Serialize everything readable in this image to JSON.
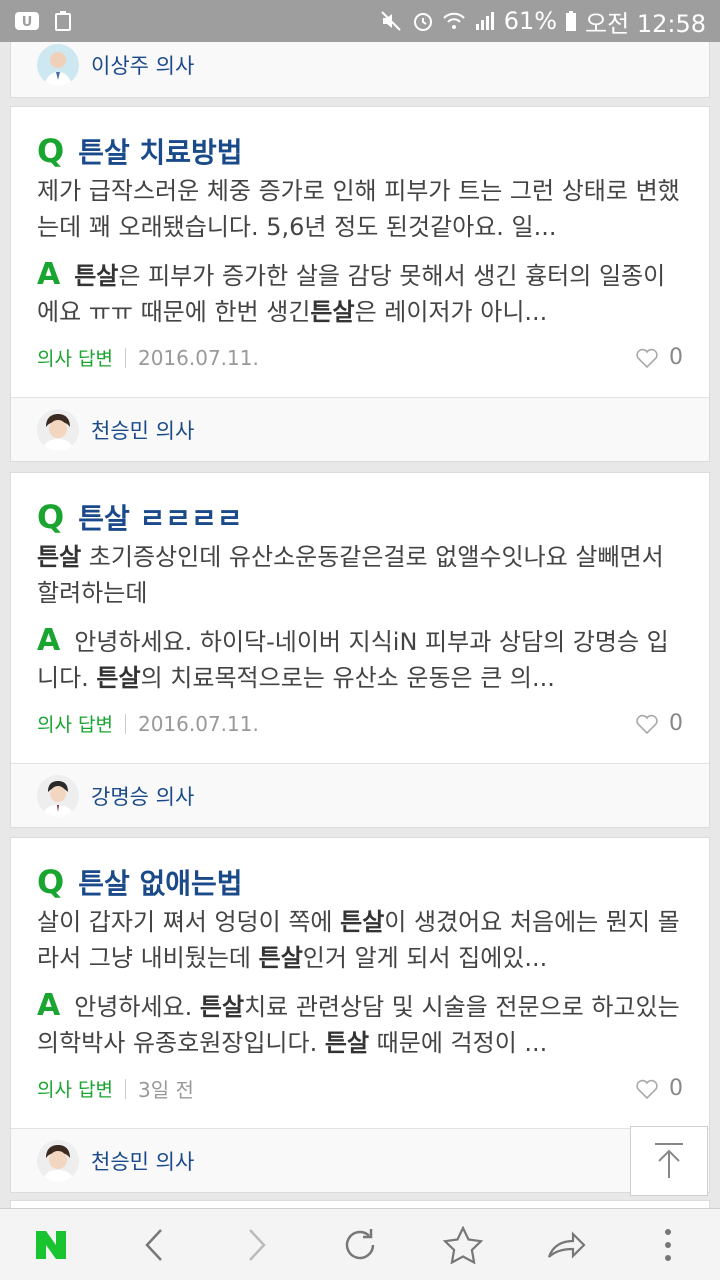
{
  "status": {
    "battery": "61%",
    "time": "오전 12:58"
  },
  "top_doctor": {
    "name": "이상주 의사"
  },
  "cards": [
    {
      "q_letter": "Q",
      "title": "튼살 치료방법",
      "question": "제가 급작스러운 체중 증가로 인해 피부가 트는 그런 상태로 변했는데 꽤 오래됐습니다. 5,6년 정도 된것같아요. 일...",
      "a_letter": "A",
      "answer_hl": "튼살",
      "answer_pre": "",
      "answer_rest1": "은 피부가 증가한 살을 감당 못해서 생긴 흉터의 일종이에요 ㅠㅠ 때문에 한번 생긴",
      "answer_hl2": "튼살",
      "answer_rest2": "은 레이저가 아니...",
      "label": "의사 답변",
      "date": "2016.07.11.",
      "likes": "0",
      "doctor": "천승민 의사"
    },
    {
      "q_letter": "Q",
      "title": "튼살 ㄹㄹㄹㄹ",
      "question_hl": "튼살",
      "question": " 초기증상인데 유산소운동같은걸로 없앨수잇나요 살빼면서 할려하는데",
      "a_letter": "A",
      "answer_pre": "안녕하세요. 하이닥-네이버 지식iN 피부과 상담의 강명승 입니다. ",
      "answer_hl": "튼살",
      "answer_rest1": "의 치료목적으로는 유산소 운동은 큰 의...",
      "label": "의사 답변",
      "date": "2016.07.11.",
      "likes": "0",
      "doctor": "강명승 의사"
    },
    {
      "q_letter": "Q",
      "title": "튼살 없애는법",
      "question_pre": "살이 갑자기 쪄서 엉덩이 쪽에 ",
      "question_hl": "튼살",
      "question_mid": "이 생겼어요 처음에는 뭔지 몰라서 그냥 내비뒀는데 ",
      "question_hl2": "튼살",
      "question_rest": "인거 알게 되서 집에있...",
      "a_letter": "A",
      "answer_pre": "안녕하세요. ",
      "answer_hl": "튼살",
      "answer_rest1": "치료 관련상담 및 시술을 전문으로 하고있는 의학박사 유종호원장입니다. ",
      "answer_hl2": "튼살",
      "answer_rest2": " 때문에 걱정이 ...",
      "label": "의사 답변",
      "date": "3일 전",
      "likes": "0",
      "doctor": "천승민 의사"
    }
  ]
}
